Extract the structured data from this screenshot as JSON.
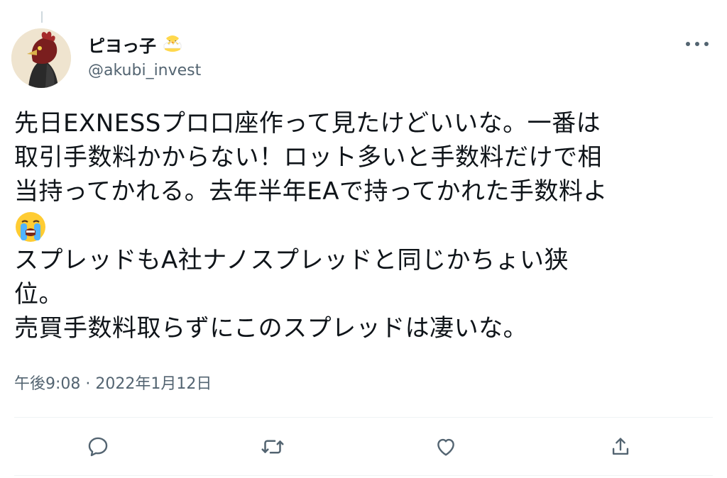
{
  "tweet": {
    "author": {
      "display_name": "ピヨっ子",
      "display_name_emoji": "chick-emoji",
      "handle": "@akubi_invest"
    },
    "lines": [
      "先日EXNESSプロ口座作って見たけどいいな。一番は",
      "取引手数料かからない！ロット多いと手数料だけで相",
      "当持ってかれる。去年半年EAで持ってかれた手数料よ",
      "スプレッドもA社ナノスプレッドと同じかちょい狭",
      "位。",
      "売買手数料取らずにこのスプレッドは凄いな。"
    ],
    "inline_emoji": "loudly-crying-face-emoji",
    "timestamp": "午後9:08 · 2022年1月12日"
  },
  "actions": {
    "reply_icon": "reply-icon",
    "retweet_icon": "retweet-icon",
    "like_icon": "heart-icon",
    "share_icon": "share-icon"
  },
  "colors": {
    "text": "#0f1419",
    "secondary": "#536471",
    "divider": "#eff3f4"
  }
}
